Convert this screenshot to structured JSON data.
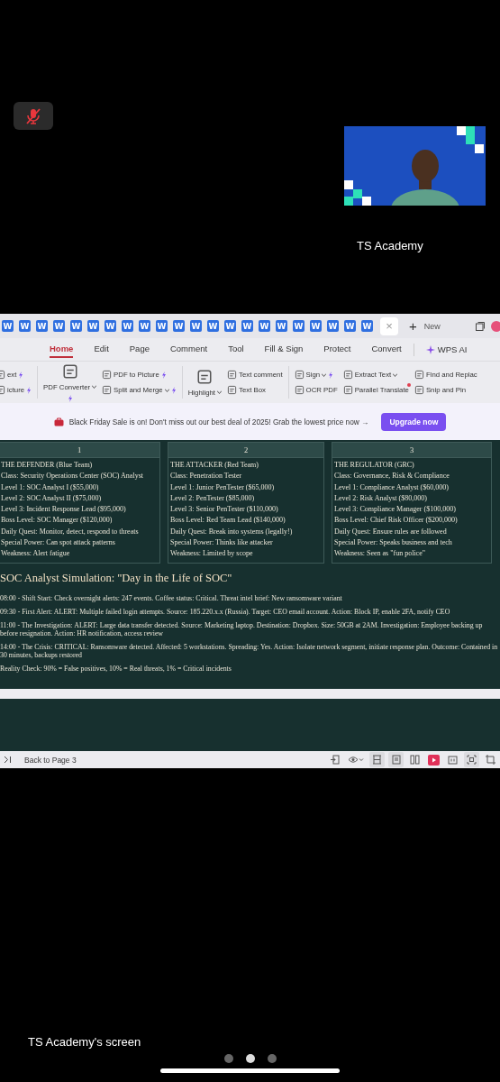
{
  "call": {
    "mic_muted": true,
    "participant_name": "TS Academy"
  },
  "shared_screen": {
    "doc_tabs": [
      {
        "icon_letter": "W",
        "selected": false
      },
      {
        "icon_letter": "W",
        "selected": false
      },
      {
        "icon_letter": "W",
        "selected": false
      },
      {
        "icon_letter": "W",
        "selected": false
      },
      {
        "icon_letter": "W",
        "selected": false
      },
      {
        "icon_letter": "W",
        "selected": false
      },
      {
        "icon_letter": "W",
        "selected": false
      },
      {
        "icon_letter": "W",
        "selected": false
      },
      {
        "icon_letter": "W",
        "selected": false
      },
      {
        "icon_letter": "W",
        "selected": false
      },
      {
        "icon_letter": "W",
        "selected": false
      },
      {
        "icon_letter": "W",
        "selected": false
      },
      {
        "icon_letter": "W",
        "selected": false
      },
      {
        "icon_letter": "W",
        "selected": false
      },
      {
        "icon_letter": "W",
        "selected": false
      },
      {
        "icon_letter": "W",
        "selected": false
      },
      {
        "icon_letter": "W",
        "selected": false
      },
      {
        "icon_letter": "W",
        "selected": false
      },
      {
        "icon_letter": "W",
        "selected": false
      },
      {
        "icon_letter": "W",
        "selected": false
      },
      {
        "icon_letter": "W",
        "selected": false
      },
      {
        "icon_letter": "W",
        "selected": false
      }
    ],
    "active_tab_close": "×",
    "new_tab": {
      "icon": "+",
      "label": "New"
    },
    "menu": [
      {
        "label": "Home",
        "selected": true
      },
      {
        "label": "Edit",
        "selected": false
      },
      {
        "label": "Page",
        "selected": false
      },
      {
        "label": "Comment",
        "selected": false
      },
      {
        "label": "Tool",
        "selected": false
      },
      {
        "label": "Fill & Sign",
        "selected": false
      },
      {
        "label": "Protect",
        "selected": false
      },
      {
        "label": "Convert",
        "selected": false
      }
    ],
    "ai_menu": "WPS AI",
    "toolbar_groups": [
      {
        "separator_after": true,
        "items": [
          {
            "label": "ext",
            "large": false,
            "dropdown": false,
            "sparkle": true,
            "new_dot": false
          },
          {
            "label": "icture",
            "large": false,
            "dropdown": false,
            "sparkle": true,
            "new_dot": false
          }
        ]
      },
      {
        "separator_after": false,
        "items": [
          {
            "label": "PDF Converter",
            "large": true,
            "dropdown": true,
            "sparkle": true,
            "new_dot": false
          }
        ]
      },
      {
        "separator_after": true,
        "items": [
          {
            "label": "PDF to Picture",
            "large": false,
            "dropdown": false,
            "sparkle": true,
            "new_dot": false
          },
          {
            "label": "Split and Merge",
            "large": false,
            "dropdown": true,
            "sparkle": true,
            "new_dot": false
          }
        ]
      },
      {
        "separator_after": false,
        "items": [
          {
            "label": "Highlight",
            "large": true,
            "dropdown": true,
            "sparkle": false,
            "new_dot": false
          }
        ]
      },
      {
        "separator_after": true,
        "items": [
          {
            "label": "Text comment",
            "large": false,
            "dropdown": false,
            "sparkle": false,
            "new_dot": false
          },
          {
            "label": "Text Box",
            "large": false,
            "dropdown": false,
            "sparkle": false,
            "new_dot": false
          }
        ]
      },
      {
        "separator_after": false,
        "items": [
          {
            "label": "Sign",
            "large": false,
            "dropdown": true,
            "sparkle": true,
            "new_dot": false
          },
          {
            "label": "OCR PDF",
            "large": false,
            "dropdown": false,
            "sparkle": false,
            "new_dot": false
          }
        ]
      },
      {
        "separator_after": false,
        "items": [
          {
            "label": "Extract Text",
            "large": false,
            "dropdown": true,
            "sparkle": false,
            "new_dot": false
          },
          {
            "label": "Parallel Translate",
            "large": false,
            "dropdown": false,
            "sparkle": false,
            "new_dot": true
          }
        ]
      },
      {
        "separator_after": false,
        "items": [
          {
            "label": "Find and Replac",
            "large": false,
            "dropdown": false,
            "sparkle": false,
            "new_dot": false
          },
          {
            "label": "Snip and Pin",
            "large": false,
            "dropdown": false,
            "sparkle": false,
            "new_dot": false
          }
        ]
      }
    ],
    "banner": {
      "text": "Black Friday Sale is on! Don't miss out our best deal of 2025! Grab the lowest price now →",
      "button": "Upgrade now"
    },
    "table": {
      "columns": [
        "1",
        "2",
        "3"
      ],
      "cells": [
        [
          "THE DEFENDER (Blue Team)",
          "Class: Security Operations Center (SOC) Analyst",
          "Level 1: SOC Analyst I ($55,000)",
          "Level 2: SOC Analyst II ($75,000)",
          "Level 3: Incident Response Lead ($95,000)",
          "Boss Level: SOC Manager ($120,000)",
          "Daily Quest: Monitor, detect, respond to threats",
          "Special Power: Can spot attack patterns",
          "Weakness: Alert fatigue"
        ],
        [
          "THE ATTACKER (Red Team)",
          "Class: Penetration Tester",
          "Level 1: Junior PenTester ($65,000)",
          "Level 2: PenTester ($85,000)",
          "Level 3: Senior PenTester ($110,000)",
          "Boss Level: Red Team Lead ($140,000)",
          "Daily Quest: Break into systems (legally!)",
          "Special Power: Thinks like attacker",
          "Weakness: Limited by scope"
        ],
        [
          "THE REGULATOR (GRC)",
          "Class: Governance, Risk & Compliance",
          "Level 1: Compliance Analyst ($60,000)",
          "Level 2: Risk Analyst ($80,000)",
          "Level 3: Compliance Manager ($100,000)",
          "Boss Level: Chief Risk Officer ($200,000)",
          "Daily Quest: Ensure rules are followed",
          "Special Power: Speaks business and tech",
          "Weakness: Seen as \"fun police\""
        ]
      ]
    },
    "simulation": {
      "title": "SOC Analyst Simulation: \"Day in the Life of SOC\"",
      "paragraphs": [
        "08:00 - Shift Start: Check overnight alerts: 247 events. Coffee status: Critical. Threat intel brief: New ransomware variant",
        "09:30 - First Alert: ALERT: Multiple failed login attempts. Source: 185.220.x.x (Russia). Target: CEO email account. Action: Block IP, enable 2FA, notify CEO",
        "11:00 - The Investigation: ALERT: Large data transfer detected. Source: Marketing laptop. Destination: Dropbox. Size: 50GB at 2AM. Investigation: Employee backing up before resignation. Action: HR notification, access review",
        "14:00 - The Crisis: CRITICAL: Ransomware detected. Affected: 5 workstations. Spreading: Yes. Action: Isolate network segment, initiate response plan. Outcome: Contained in 30 minutes, backups restored",
        "Reality Check: 90% = False positives, 10% = Real threats, 1% = Critical incidents"
      ]
    },
    "status_bar": {
      "back_link": "Back to Page 3",
      "view_buttons": [
        {
          "selected": false
        },
        {
          "selected": false
        },
        {
          "selected": true
        },
        {
          "selected": true
        },
        {
          "selected": false
        },
        {
          "selected": false
        },
        {
          "selected": false
        },
        {
          "selected": true
        },
        {
          "selected": false
        }
      ]
    }
  },
  "caption": "TS Academy's screen",
  "page_dots": [
    {
      "selected": false
    },
    {
      "selected": true
    },
    {
      "selected": false
    }
  ]
}
